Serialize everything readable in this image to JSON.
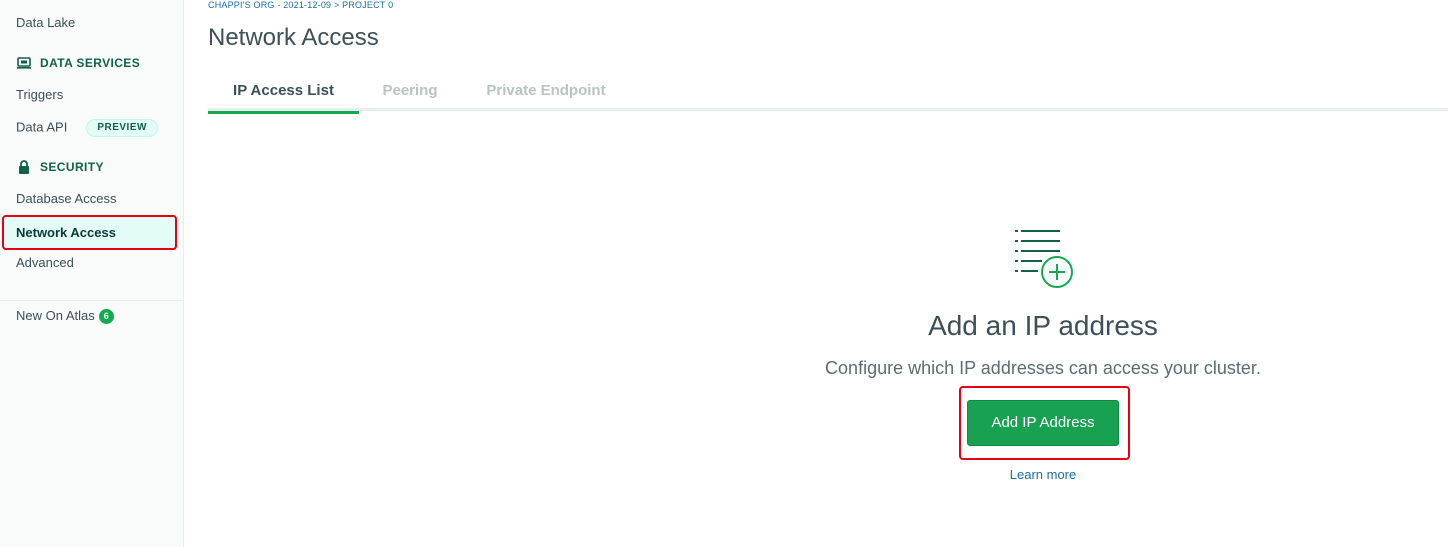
{
  "sidebar": {
    "data_lake": "Data Lake",
    "data_services_heading": "DATA SERVICES",
    "triggers": "Triggers",
    "data_api": "Data API",
    "preview_badge": "PREVIEW",
    "security_heading": "SECURITY",
    "database_access": "Database Access",
    "network_access": "Network Access",
    "advanced": "Advanced",
    "new_on_atlas": "New On Atlas",
    "new_on_atlas_count": "6"
  },
  "header": {
    "breadcrumb": "CHAPPI'S ORG - 2021-12-09 > PROJECT 0",
    "title": "Network Access"
  },
  "tabs": [
    {
      "label": "IP Access List",
      "active": true
    },
    {
      "label": "Peering",
      "active": false
    },
    {
      "label": "Private Endpoint",
      "active": false
    }
  ],
  "empty_state": {
    "icon": "list-add-icon",
    "title": "Add an IP address",
    "description": "Configure which IP addresses can access your cluster.",
    "button_label": "Add IP Address",
    "learn_more": "Learn more"
  },
  "colors": {
    "accent_green": "#13aa52",
    "highlight_red": "#e60012",
    "link_blue": "#1a6eaa"
  }
}
